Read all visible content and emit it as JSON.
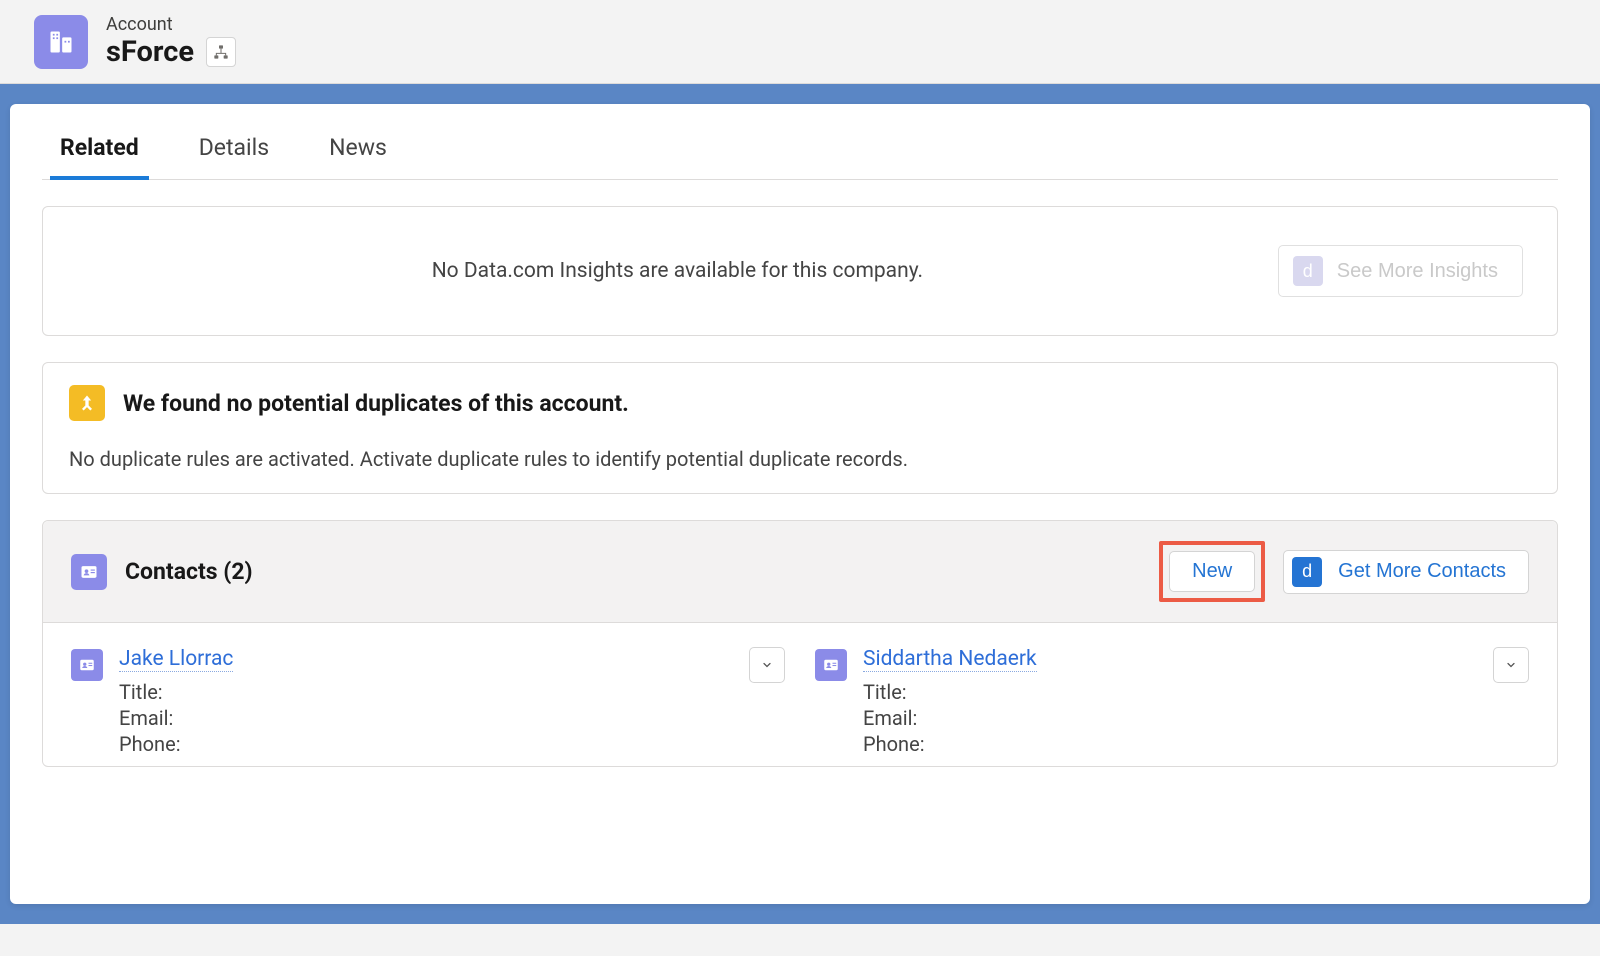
{
  "header": {
    "entity_type": "Account",
    "entity_name": "sForce"
  },
  "tabs": [
    {
      "label": "Related",
      "active": true
    },
    {
      "label": "Details",
      "active": false
    },
    {
      "label": "News",
      "active": false
    }
  ],
  "insights": {
    "empty_text": "No Data.com Insights are available for this company.",
    "more_button": "See More Insights"
  },
  "duplicates": {
    "title": "We found no potential duplicates of this account.",
    "description": "No duplicate rules are activated. Activate duplicate rules to identify potential duplicate records."
  },
  "contacts": {
    "title": "Contacts (2)",
    "new_button": "New",
    "get_more_button": "Get More Contacts",
    "field_labels": {
      "title": "Title:",
      "email": "Email:",
      "phone": "Phone:"
    },
    "items": [
      {
        "name": "Jake Llorrac",
        "title": "",
        "email": "",
        "phone": ""
      },
      {
        "name": "Siddartha Nedaerk",
        "title": "",
        "email": "",
        "phone": ""
      }
    ]
  }
}
